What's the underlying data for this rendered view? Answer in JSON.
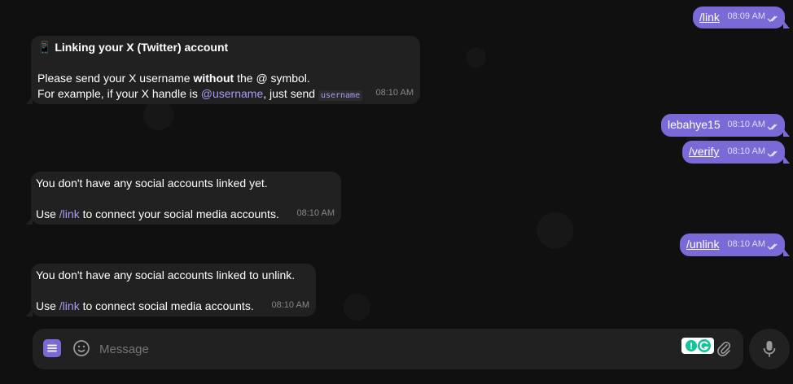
{
  "messages": {
    "out_link": {
      "text": "/link",
      "time": "08:09 AM"
    },
    "in_twitter": {
      "emoji": "📱",
      "title": "Linking your X (Twitter) account",
      "line1_a": "Please send your X username ",
      "line1_b": "without",
      "line1_c": " the @ symbol.",
      "line2_a": "For example, if your X handle is ",
      "line2_handle": "@username",
      "line2_b": ", just send ",
      "line2_code": "username",
      "time": "08:10 AM"
    },
    "out_username": {
      "text": "lebahye15",
      "time": "08:10 AM"
    },
    "out_verify": {
      "text": "/verify",
      "time": "08:10 AM"
    },
    "in_no_accounts": {
      "line1": "You don't have any social accounts linked yet.",
      "line2_a": "Use ",
      "line2_link": "/link",
      "line2_b": " to connect your social media accounts.",
      "time": "08:10 AM"
    },
    "out_unlink": {
      "text": "/unlink",
      "time": "08:10 AM"
    },
    "in_no_unlink": {
      "line1": "You don't have any social accounts linked to unlink.",
      "line2_a": "Use ",
      "line2_link": "/link",
      "line2_b": " to connect social media accounts.",
      "time": "08:10 AM"
    }
  },
  "composer": {
    "placeholder": "Message"
  },
  "colors": {
    "accent": "#7a6ad8",
    "bubble_in": "#212121",
    "link": "#a99cf5"
  }
}
